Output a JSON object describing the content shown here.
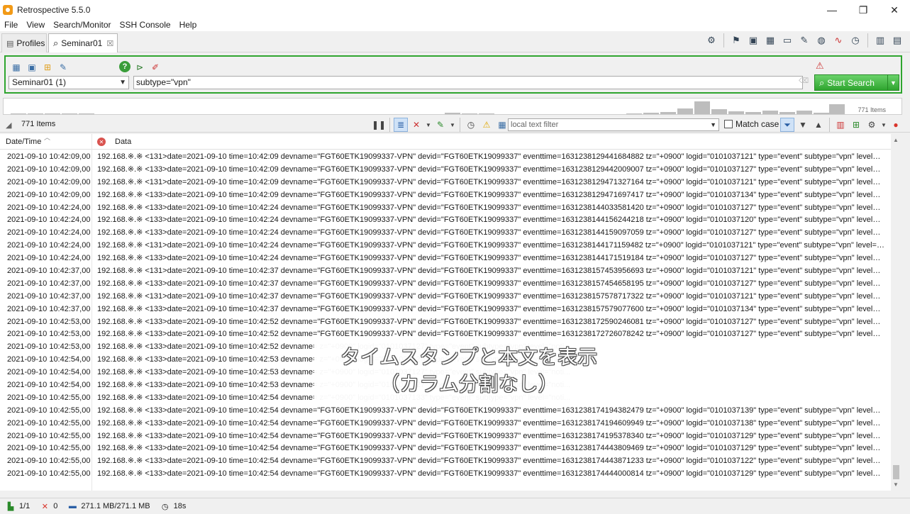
{
  "window": {
    "title": "Retrospective 5.5.0",
    "controls": [
      "—",
      "❐",
      "✕"
    ]
  },
  "menu": [
    "File",
    "View",
    "Search/Monitor",
    "SSH Console",
    "Help"
  ],
  "tabs": [
    {
      "label": "Profiles"
    },
    {
      "label": "Seminar01",
      "close": "☒"
    }
  ],
  "search": {
    "profile_select": "Seminar01 (1)",
    "query": "subtype=\"vpn\"",
    "start_button": "Start Search"
  },
  "histogram": {
    "count_label": "771 Items"
  },
  "results": {
    "items_count": "771 Items",
    "text_filter_placeholder": "local text filter",
    "match_case_label": "Match case"
  },
  "table": {
    "columns": [
      "Date/Time",
      "Data"
    ],
    "rows": [
      {
        "date": "2021-09-10 10:42:09,00",
        "data": "192.168.※.※ <131>date=2021-09-10 time=10:42:09 devname=\"FGT60ETK19099337-VPN\" devid=\"FGT60ETK19099337\" eventtime=1631238129441684882 tz=\"+0900\" logid=\"0101037121\" type=\"event\" subtype=\"vpn\" level=\"error..."
      },
      {
        "date": "2021-09-10 10:42:09,00",
        "data": "192.168.※.※ <133>date=2021-09-10 time=10:42:09 devname=\"FGT60ETK19099337-VPN\" devid=\"FGT60ETK19099337\" eventtime=1631238129442009007 tz=\"+0900\" logid=\"0101037127\" type=\"event\" subtype=\"vpn\" level=\"noti..."
      },
      {
        "date": "2021-09-10 10:42:09,00",
        "data": "192.168.※.※ <131>date=2021-09-10 time=10:42:09 devname=\"FGT60ETK19099337-VPN\" devid=\"FGT60ETK19099337\" eventtime=1631238129471327164 tz=\"+0900\" logid=\"0101037121\" type=\"event\" subtype=\"vpn\" level=\"error..."
      },
      {
        "date": "2021-09-10 10:42:09,00",
        "data": "192.168.※.※ <133>date=2021-09-10 time=10:42:09 devname=\"FGT60ETK19099337-VPN\" devid=\"FGT60ETK19099337\" eventtime=1631238129471697417 tz=\"+0900\" logid=\"0101037134\" type=\"event\" subtype=\"vpn\" level=\"noti..."
      },
      {
        "date": "2021-09-10 10:42:24,00",
        "data": "192.168.※.※ <133>date=2021-09-10 time=10:42:24 devname=\"FGT60ETK19099337-VPN\" devid=\"FGT60ETK19099337\" eventtime=1631238144033581420 tz=\"+0900\" logid=\"0101037127\" type=\"event\" subtype=\"vpn\" level=\"noti..."
      },
      {
        "date": "2021-09-10 10:42:24,00",
        "data": "192.168.※.※ <133>date=2021-09-10 time=10:42:24 devname=\"FGT60ETK19099337-VPN\" devid=\"FGT60ETK19099337\" eventtime=1631238144156244218 tz=\"+0900\" logid=\"0101037120\" type=\"event\" subtype=\"vpn\" level=\"noti..."
      },
      {
        "date": "2021-09-10 10:42:24,00",
        "data": "192.168.※.※ <133>date=2021-09-10 time=10:42:24 devname=\"FGT60ETK19099337-VPN\" devid=\"FGT60ETK19099337\" eventtime=1631238144159097059 tz=\"+0900\" logid=\"0101037127\" type=\"event\" subtype=\"vpn\" level=\"noti..."
      },
      {
        "date": "2021-09-10 10:42:24,00",
        "data": "192.168.※.※ <131>date=2021-09-10 time=10:42:24 devname=\"FGT60ETK19099337-VPN\" devid=\"FGT60ETK19099337\" eventtime=1631238144171159482 tz=\"+0900\" logid=\"0101037121\" type=\"event\" subtype=\"vpn\" level=\"error..."
      },
      {
        "date": "2021-09-10 10:42:24,00",
        "data": "192.168.※.※ <133>date=2021-09-10 time=10:42:24 devname=\"FGT60ETK19099337-VPN\" devid=\"FGT60ETK19099337\" eventtime=1631238144171519184 tz=\"+0900\" logid=\"0101037127\" type=\"event\" subtype=\"vpn\" level=\"noti..."
      },
      {
        "date": "2021-09-10 10:42:37,00",
        "data": "192.168.※.※ <131>date=2021-09-10 time=10:42:37 devname=\"FGT60ETK19099337-VPN\" devid=\"FGT60ETK19099337\" eventtime=1631238157453956693 tz=\"+0900\" logid=\"0101037121\" type=\"event\" subtype=\"vpn\" level=\"error..."
      },
      {
        "date": "2021-09-10 10:42:37,00",
        "data": "192.168.※.※ <133>date=2021-09-10 time=10:42:37 devname=\"FGT60ETK19099337-VPN\" devid=\"FGT60ETK19099337\" eventtime=1631238157454658195 tz=\"+0900\" logid=\"0101037127\" type=\"event\" subtype=\"vpn\" level=\"noti..."
      },
      {
        "date": "2021-09-10 10:42:37,00",
        "data": "192.168.※.※ <131>date=2021-09-10 time=10:42:37 devname=\"FGT60ETK19099337-VPN\" devid=\"FGT60ETK19099337\" eventtime=1631238157578717322 tz=\"+0900\" logid=\"0101037121\" type=\"event\" subtype=\"vpn\" level=\"error..."
      },
      {
        "date": "2021-09-10 10:42:37,00",
        "data": "192.168.※.※ <133>date=2021-09-10 time=10:42:37 devname=\"FGT60ETK19099337-VPN\" devid=\"FGT60ETK19099337\" eventtime=1631238157579077600 tz=\"+0900\" logid=\"0101037134\" type=\"event\" subtype=\"vpn\" level=\"noti..."
      },
      {
        "date": "2021-09-10 10:42:53,00",
        "data": "192.168.※.※ <133>date=2021-09-10 time=10:42:52 devname=\"FGT60ETK19099337-VPN\" devid=\"FGT60ETK19099337\" eventtime=1631238172590246081 tz=\"+0900\" logid=\"0101037127\" type=\"event\" subtype=\"vpn\" level=\"noti..."
      },
      {
        "date": "2021-09-10 10:42:53,00",
        "data": "192.168.※.※ <133>date=2021-09-10 time=10:42:52 devname=\"FGT60ETK19099337-VPN\" devid=\"FGT60ETK19099337\" eventtime=1631238172726078242 tz=\"+0900\" logid=\"0101037127\" type=\"event\" subtype=\"vpn\" level=\"noti..."
      },
      {
        "date": "2021-09-10 10:42:53,00",
        "data": "192.168.※.※ <133>date=2021-09-10 time=10:42:52 devname=                                                                                   z=\"+0900\" logid=\"0101037127\" type=\"event\" subtype=\"vpn\" level=\"noti..."
      },
      {
        "date": "2021-09-10 10:42:54,00",
        "data": "192.168.※.※ <133>date=2021-09-10 time=10:42:53 devname=                                                                                   z=\"+0900\" logid=\"0101037120\" type=\"event\" subtype=\"vpn\" level=\"noti..."
      },
      {
        "date": "2021-09-10 10:42:54,00",
        "data": "192.168.※.※ <133>date=2021-09-10 time=10:42:53 devname=                                                                                   z=\"+0900\" logid=\"0101037127\" type=\"event\" subtype=\"vpn\" level=\"noti..."
      },
      {
        "date": "2021-09-10 10:42:54,00",
        "data": "192.168.※.※ <133>date=2021-09-10 time=10:42:53 devname=                                                                                   z=\"+0900\" logid=\"0101037127\" type=\"event\" subtype=\"vpn\" level=\"noti..."
      },
      {
        "date": "2021-09-10 10:42:55,00",
        "data": "192.168.※.※ <133>date=2021-09-10 time=10:42:54 devname=                                                                                   z=\"+0900\" logid=\"0101037133\" type=\"event\" subtype=\"vpn\" level=\"noti..."
      },
      {
        "date": "2021-09-10 10:42:55,00",
        "data": "192.168.※.※ <133>date=2021-09-10 time=10:42:54 devname=\"FGT60ETK19099337-VPN\" devid=\"FGT60ETK19099337\" eventtime=1631238174194382479 tz=\"+0900\" logid=\"0101037139\" type=\"event\" subtype=\"vpn\" level=\"noti..."
      },
      {
        "date": "2021-09-10 10:42:55,00",
        "data": "192.168.※.※ <133>date=2021-09-10 time=10:42:54 devname=\"FGT60ETK19099337-VPN\" devid=\"FGT60ETK19099337\" eventtime=1631238174194609949 tz=\"+0900\" logid=\"0101037138\" type=\"event\" subtype=\"vpn\" level=\"noti..."
      },
      {
        "date": "2021-09-10 10:42:55,00",
        "data": "192.168.※.※ <133>date=2021-09-10 time=10:42:54 devname=\"FGT60ETK19099337-VPN\" devid=\"FGT60ETK19099337\" eventtime=1631238174195378340 tz=\"+0900\" logid=\"0101037129\" type=\"event\" subtype=\"vpn\" level=\"noti..."
      },
      {
        "date": "2021-09-10 10:42:55,00",
        "data": "192.168.※.※ <133>date=2021-09-10 time=10:42:54 devname=\"FGT60ETK19099337-VPN\" devid=\"FGT60ETK19099337\" eventtime=1631238174443809469 tz=\"+0900\" logid=\"0101037129\" type=\"event\" subtype=\"vpn\" level=\"noti..."
      },
      {
        "date": "2021-09-10 10:42:55,00",
        "data": "192.168.※.※ <133>date=2021-09-10 time=10:42:54 devname=\"FGT60ETK19099337-VPN\" devid=\"FGT60ETK19099337\" eventtime=1631238174443871233 tz=\"+0900\" logid=\"0101037122\" type=\"event\" subtype=\"vpn\" level=\"noti..."
      },
      {
        "date": "2021-09-10 10:42:55,00",
        "data": "192.168.※.※ <133>date=2021-09-10 time=10:42:54 devname=\"FGT60ETK19099337-VPN\" devid=\"FGT60ETK19099337\" eventtime=1631238174444000814 tz=\"+0900\" logid=\"0101037129\" type=\"event\" subtype=\"vpn\" level=\"noti..."
      }
    ]
  },
  "overlay": {
    "line1": "タイムスタンプと本文を表示",
    "line2": "（カラム分割なし）"
  },
  "status": {
    "pages": "1/1",
    "errors": "0",
    "memory": "271.1 MB/271.1 MB",
    "elapsed": "18s"
  },
  "colors": {
    "accent_green": "#2fa52f",
    "error_red": "#d9534f",
    "histogram_bar": "#bdbdbd"
  }
}
